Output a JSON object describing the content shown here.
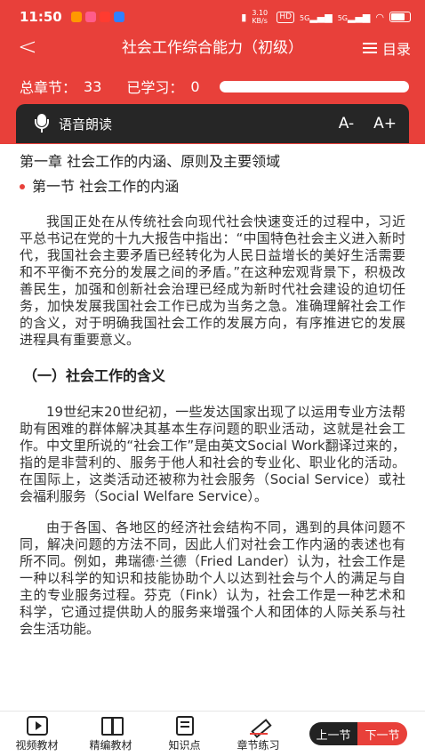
{
  "status_bar": {
    "time": "11:50",
    "speed": "3.10 KB/s",
    "hd": "HD",
    "sig1": "5G",
    "sig2": "5G"
  },
  "header": {
    "back_glyph": "<",
    "title": "社会工作综合能力（初级）",
    "menu_label": "目录"
  },
  "progress": {
    "total_label": "总章节：",
    "total_value": "33",
    "learned_label": "已学习：",
    "learned_value": "0",
    "learned_fraction": 0
  },
  "voice_bar": {
    "label": "语音朗读",
    "font_down": "A-",
    "font_up": "A+"
  },
  "content": {
    "chapter": "第一章 社会工作的内涵、原则及主要领域",
    "section": "第一节 社会工作的内涵",
    "p1": "我国正处在从传统社会向现代社会快速变迁的过程中，习近平总书记在党的十九大报告中指出：“中国特色社会主义进入新时代，我国社会主要矛盾已经转化为人民日益增长的美好生活需要和不平衡不充分的发展之间的矛盾。”在这种宏观背景下，积极改善民生，加强和创新社会治理已经成为新时代社会建设的迫切任务，加快发展我国社会工作已成为当务之急。准确理解社会工作的含义，对于明确我国社会工作的发展方向，有序推进它的发展进程具有重要意义。",
    "subheading": "（一）社会工作的含义",
    "p2": "19世纪末20世纪初，一些发达国家出现了以运用专业方法帮助有困难的群体解决其基本生存问题的职业活动，这就是社会工作。中文里所说的“社会工作”是由英文Social Work翻译过来的，指的是非营利的、服务于他人和社会的专业化、职业化的活动。在国际上，这类活动还被称为社会服务（Social Service）或社会福利服务（Social Welfare Service）。",
    "p3": "由于各国、各地区的经济社会结构不同，遇到的具体问题不同，解决问题的方法不同，因此人们对社会工作内涵的表述也有所不同。例如，弗瑞德·兰德（Fried Lander）认为，社会工作是一种以科学的知识和技能协助个人以达到社会与个人的满足与自主的专业服务过程。芬克（Fink）认为，社会工作是一种艺术和科学，它通过提供助人的服务来增强个人和团体的人际关系与社会生活功能。"
  },
  "bottom_bar": {
    "tabs": [
      {
        "label": "视频教材",
        "icon": "video-icon"
      },
      {
        "label": "精编教材",
        "icon": "book-icon"
      },
      {
        "label": "知识点",
        "icon": "note-icon"
      },
      {
        "label": "章节练习",
        "icon": "pen-icon"
      }
    ],
    "prev_label": "上一节",
    "next_label": "下一节"
  },
  "colors": {
    "accent": "#e8403a",
    "voice_bar_bg": "#262626"
  }
}
